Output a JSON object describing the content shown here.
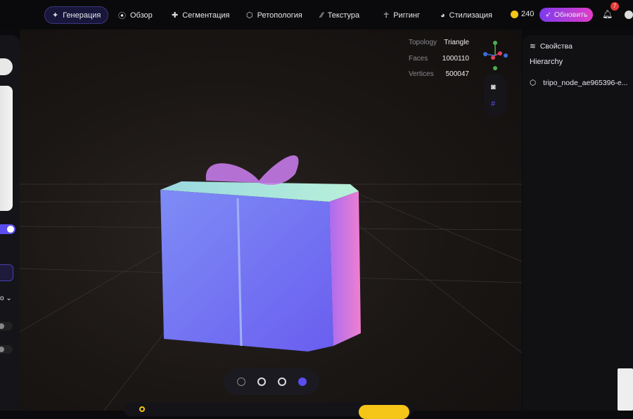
{
  "nav": [
    {
      "label": "Генерация",
      "icon": "sparkle-icon",
      "active": true
    },
    {
      "label": "Обзор",
      "icon": "scan-icon"
    },
    {
      "label": "Сегментация",
      "icon": "puzzle-icon"
    },
    {
      "label": "Ретопология",
      "icon": "mesh-icon"
    },
    {
      "label": "Текстура",
      "icon": "texture-icon"
    },
    {
      "label": "Риггинг",
      "icon": "rigging-icon"
    },
    {
      "label": "Стилизация",
      "icon": "palette-icon"
    }
  ],
  "credits": "240",
  "upgrade_label": "Обновить",
  "notification_count": "7",
  "stats": {
    "topology_label": "Topology",
    "topology": "Triangle",
    "faces_label": "Faces",
    "faces": "1000110",
    "vertices_label": "Vertices",
    "vertices": "500047"
  },
  "right_panel": {
    "title": "Свойства",
    "hierarchy": "Hierarchy",
    "node": "tripo_node_ae965396-e..."
  },
  "left_panel": {
    "dropdown_fragment": "о"
  },
  "colors": {
    "accent": "#5b4df0",
    "upgrade_start": "#7c3aed",
    "upgrade_end": "#e23dc8",
    "coin": "#f5c518"
  }
}
